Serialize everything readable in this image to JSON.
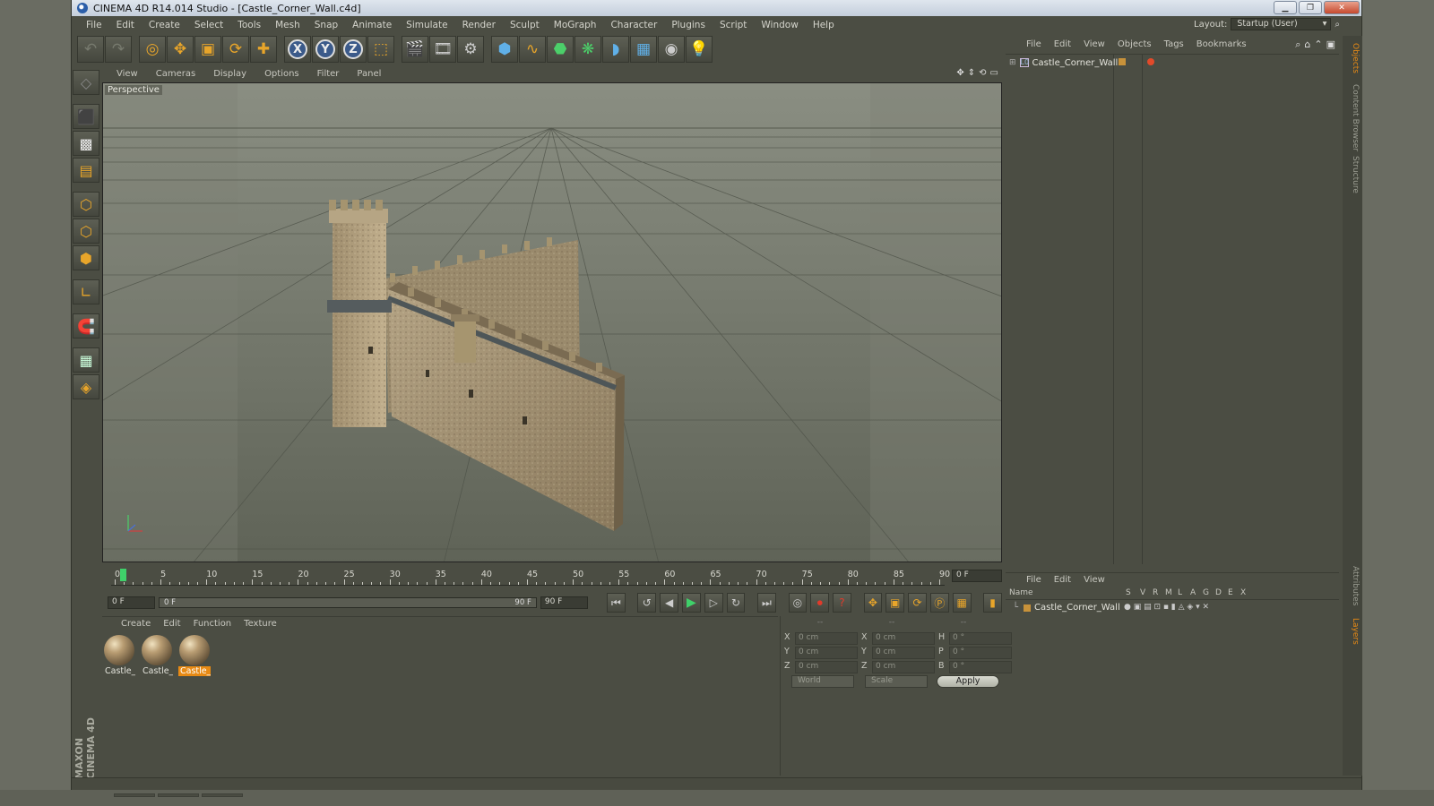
{
  "window": {
    "title": "CINEMA 4D R14.014 Studio - [Castle_Corner_Wall.c4d]",
    "buttons": [
      "▁",
      "❐",
      "✕"
    ]
  },
  "menubar": [
    "File",
    "Edit",
    "Create",
    "Select",
    "Tools",
    "Mesh",
    "Snap",
    "Animate",
    "Simulate",
    "Render",
    "Sculpt",
    "MoGraph",
    "Character",
    "Plugins",
    "Script",
    "Window",
    "Help"
  ],
  "layout": {
    "label": "Layout:",
    "value": "Startup (User)"
  },
  "viewport": {
    "menu": [
      "View",
      "Cameras",
      "Display",
      "Options",
      "Filter",
      "Panel"
    ],
    "label": "Perspective"
  },
  "timeline": {
    "ticks": [
      "0",
      "5",
      "10",
      "15",
      "20",
      "25",
      "30",
      "35",
      "40",
      "45",
      "50",
      "55",
      "60",
      "65",
      "70",
      "75",
      "80",
      "85",
      "90"
    ],
    "current_frame": "0 F",
    "start_field": "0 F",
    "slider_start": "0 F",
    "slider_end": "90 F",
    "end_field": "90 F"
  },
  "material_manager": {
    "menu": [
      "Create",
      "Edit",
      "Function",
      "Texture"
    ],
    "materials": [
      {
        "label": "Castle_c",
        "selected": false
      },
      {
        "label": "Castle_c",
        "selected": false
      },
      {
        "label": "Castle_c",
        "selected": true
      }
    ]
  },
  "coordinates": {
    "header": [
      "--",
      "--",
      "--"
    ],
    "rows": [
      {
        "l1": "X",
        "v1": "0 cm",
        "l2": "X",
        "v2": "0 cm",
        "l3": "H",
        "v3": "0 °"
      },
      {
        "l1": "Y",
        "v1": "0 cm",
        "l2": "Y",
        "v2": "0 cm",
        "l3": "P",
        "v3": "0 °"
      },
      {
        "l1": "Z",
        "v1": "0 cm",
        "l2": "Z",
        "v2": "0 cm",
        "l3": "B",
        "v3": "0 °"
      }
    ],
    "world": "World",
    "scale": "Scale",
    "apply": "Apply"
  },
  "object_manager": {
    "menu": [
      "File",
      "Edit",
      "View",
      "Objects",
      "Tags",
      "Bookmarks"
    ],
    "objects": [
      "Castle_Corner_Wall"
    ]
  },
  "layer_manager": {
    "menu": [
      "File",
      "Edit",
      "View"
    ],
    "columns": [
      "Name",
      "S",
      "V",
      "R",
      "M",
      "L",
      "A",
      "G",
      "D",
      "E",
      "X"
    ],
    "layers": [
      "Castle_Corner_Wall"
    ]
  },
  "side_tabs": [
    "Objects",
    "Content Browser",
    "Structure",
    "Attributes",
    "Layers"
  ],
  "branding": "MAXON CINEMA 4D",
  "colors": {
    "accent": "#e88a14",
    "play": "#3fd16a",
    "record": "#e23a2a",
    "panel": "#4b4d43"
  }
}
